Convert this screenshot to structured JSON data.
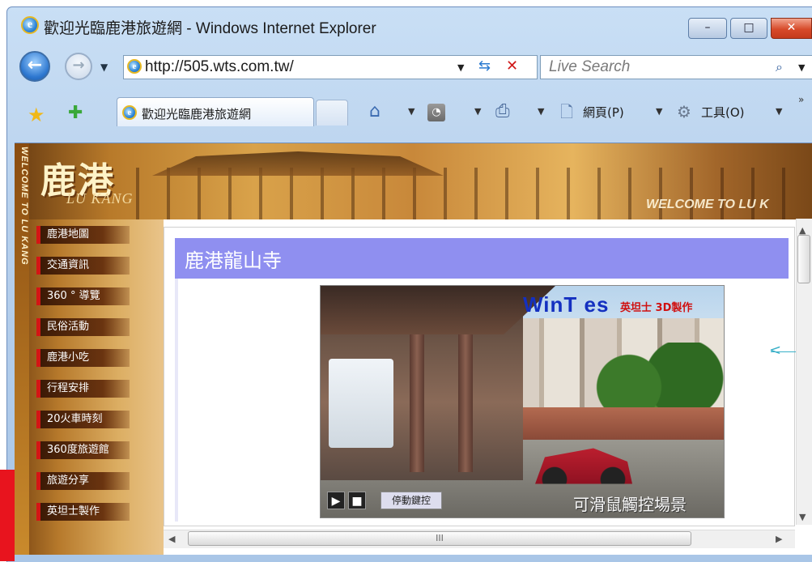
{
  "window": {
    "title": "歡迎光臨鹿港旅遊網 - Windows Internet Explorer",
    "minimize": "–",
    "maximize": "□",
    "close": "✕"
  },
  "address_bar": {
    "url": "http://505.wts.com.tw/",
    "search_placeholder": "Live Search"
  },
  "tab": {
    "label": "歡迎光臨鹿港旅遊網"
  },
  "toolbar": {
    "page_label": "網頁(P)",
    "tools_label": "工具(O)",
    "more": "»"
  },
  "site": {
    "logo": "鹿港",
    "logo_sub": "LU KANG",
    "welcome_banner": "WELCOME TO LU K",
    "vertical_text": "WELCOME TO LU KANG",
    "menu": [
      "鹿港地圖",
      "交通資訊",
      "360 ° 導覽",
      "民俗活動",
      "鹿港小吃",
      "行程安排",
      "20火車時刻",
      "360度旅遊館",
      "旅遊分享",
      "英坦士製作"
    ]
  },
  "page": {
    "title": "鹿港龍山寺",
    "panorama": {
      "logo": "WinT es",
      "logo_sub": "英坦士 3D製作",
      "play": "▶",
      "stop": "■",
      "control_label": "停動鍵控",
      "caption": "可滑鼠觸控場景"
    }
  },
  "scrollbar": {
    "h_thumb": "III"
  }
}
